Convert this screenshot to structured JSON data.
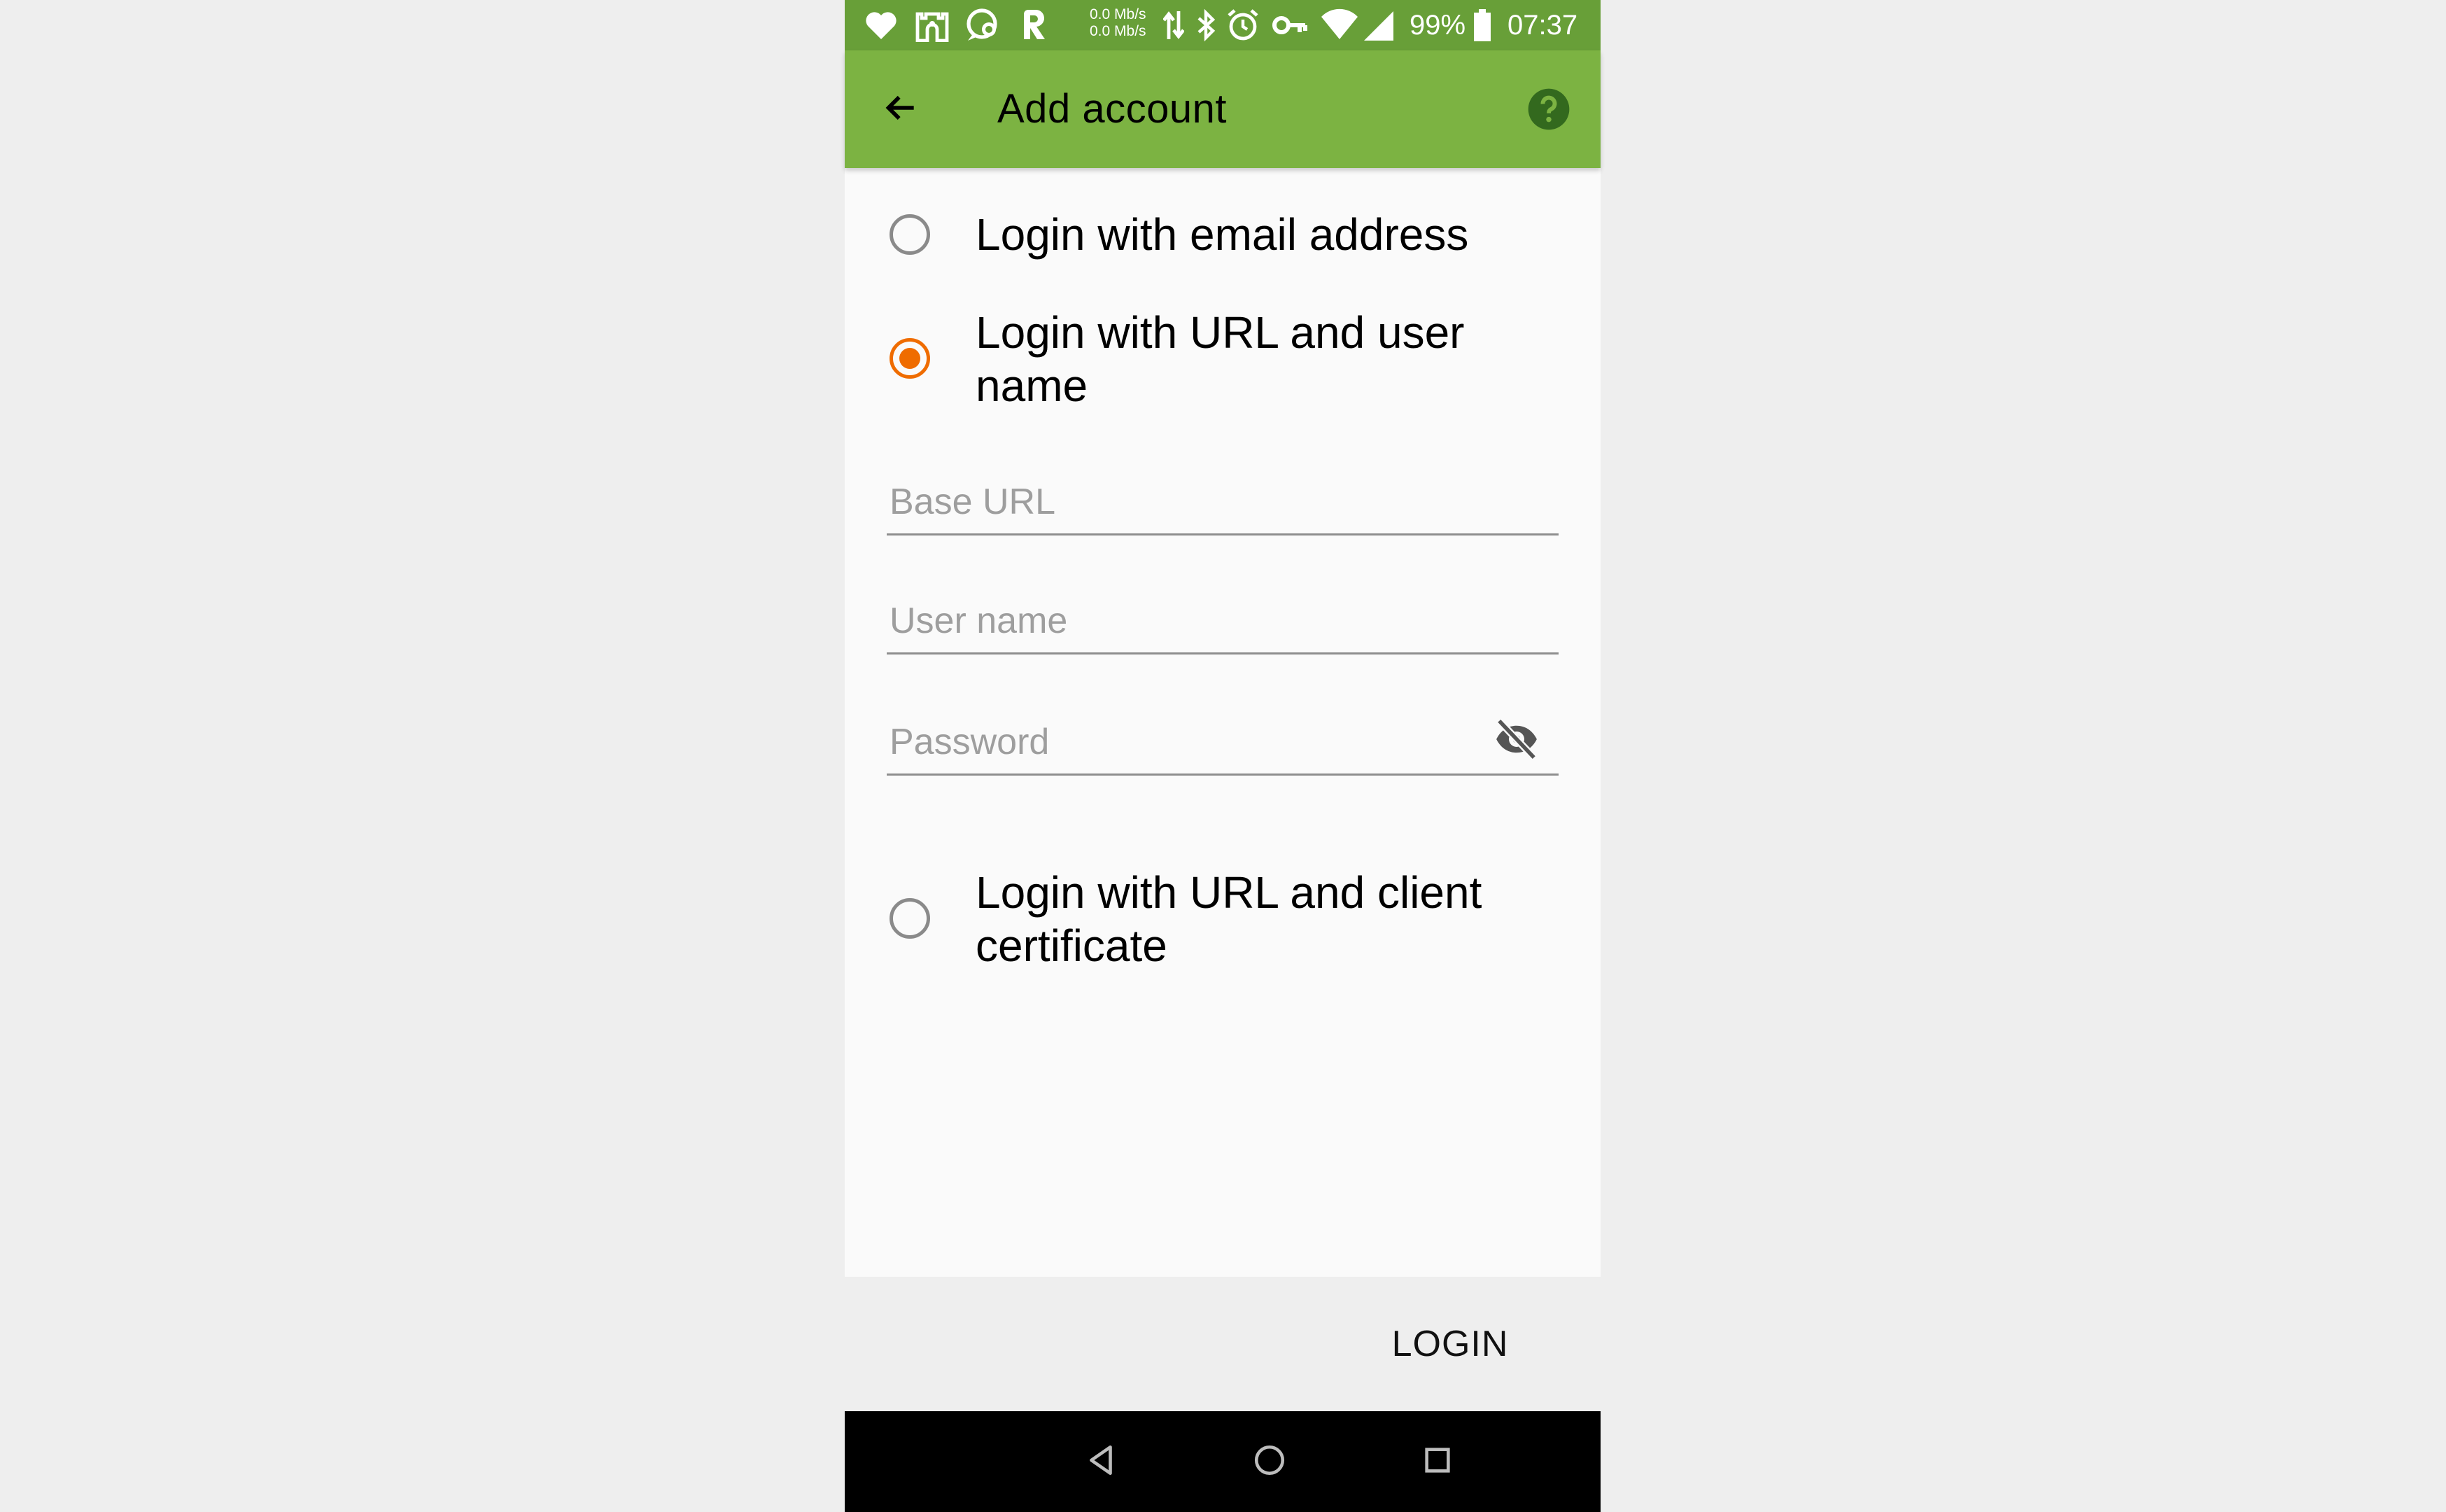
{
  "status_bar": {
    "net_speed_up": "0.0 Mb/s",
    "net_speed_down": "0.0 Mb/s",
    "battery": "99%",
    "time": "07:37",
    "icons": [
      "heart-icon",
      "castle-icon",
      "chat-bubble-icon",
      "r-app-icon",
      "data-arrows-icon",
      "bluetooth-icon",
      "alarm-icon",
      "vpn-key-icon",
      "wifi-icon",
      "signal-icon",
      "battery-icon"
    ]
  },
  "toolbar": {
    "title": "Add account",
    "back_icon": "arrow-back-icon",
    "help_icon": "help-circle-icon",
    "color": "#7cb342"
  },
  "login_options": [
    {
      "label": "Login with email address",
      "selected": false
    },
    {
      "label": "Login with URL and user name",
      "selected": true
    },
    {
      "label": "Login with URL and client certificate",
      "selected": false
    }
  ],
  "fields": {
    "base_url": {
      "placeholder": "Base URL",
      "value": ""
    },
    "user_name": {
      "placeholder": "User name",
      "value": ""
    },
    "password": {
      "placeholder": "Password",
      "value": "",
      "toggle_icon": "visibility-off-icon"
    }
  },
  "actions": {
    "login_label": "LOGIN"
  },
  "accent_color": "#ef6c00",
  "nav_bar": {
    "icons": [
      "nav-back-icon",
      "nav-home-icon",
      "nav-recents-icon"
    ]
  }
}
